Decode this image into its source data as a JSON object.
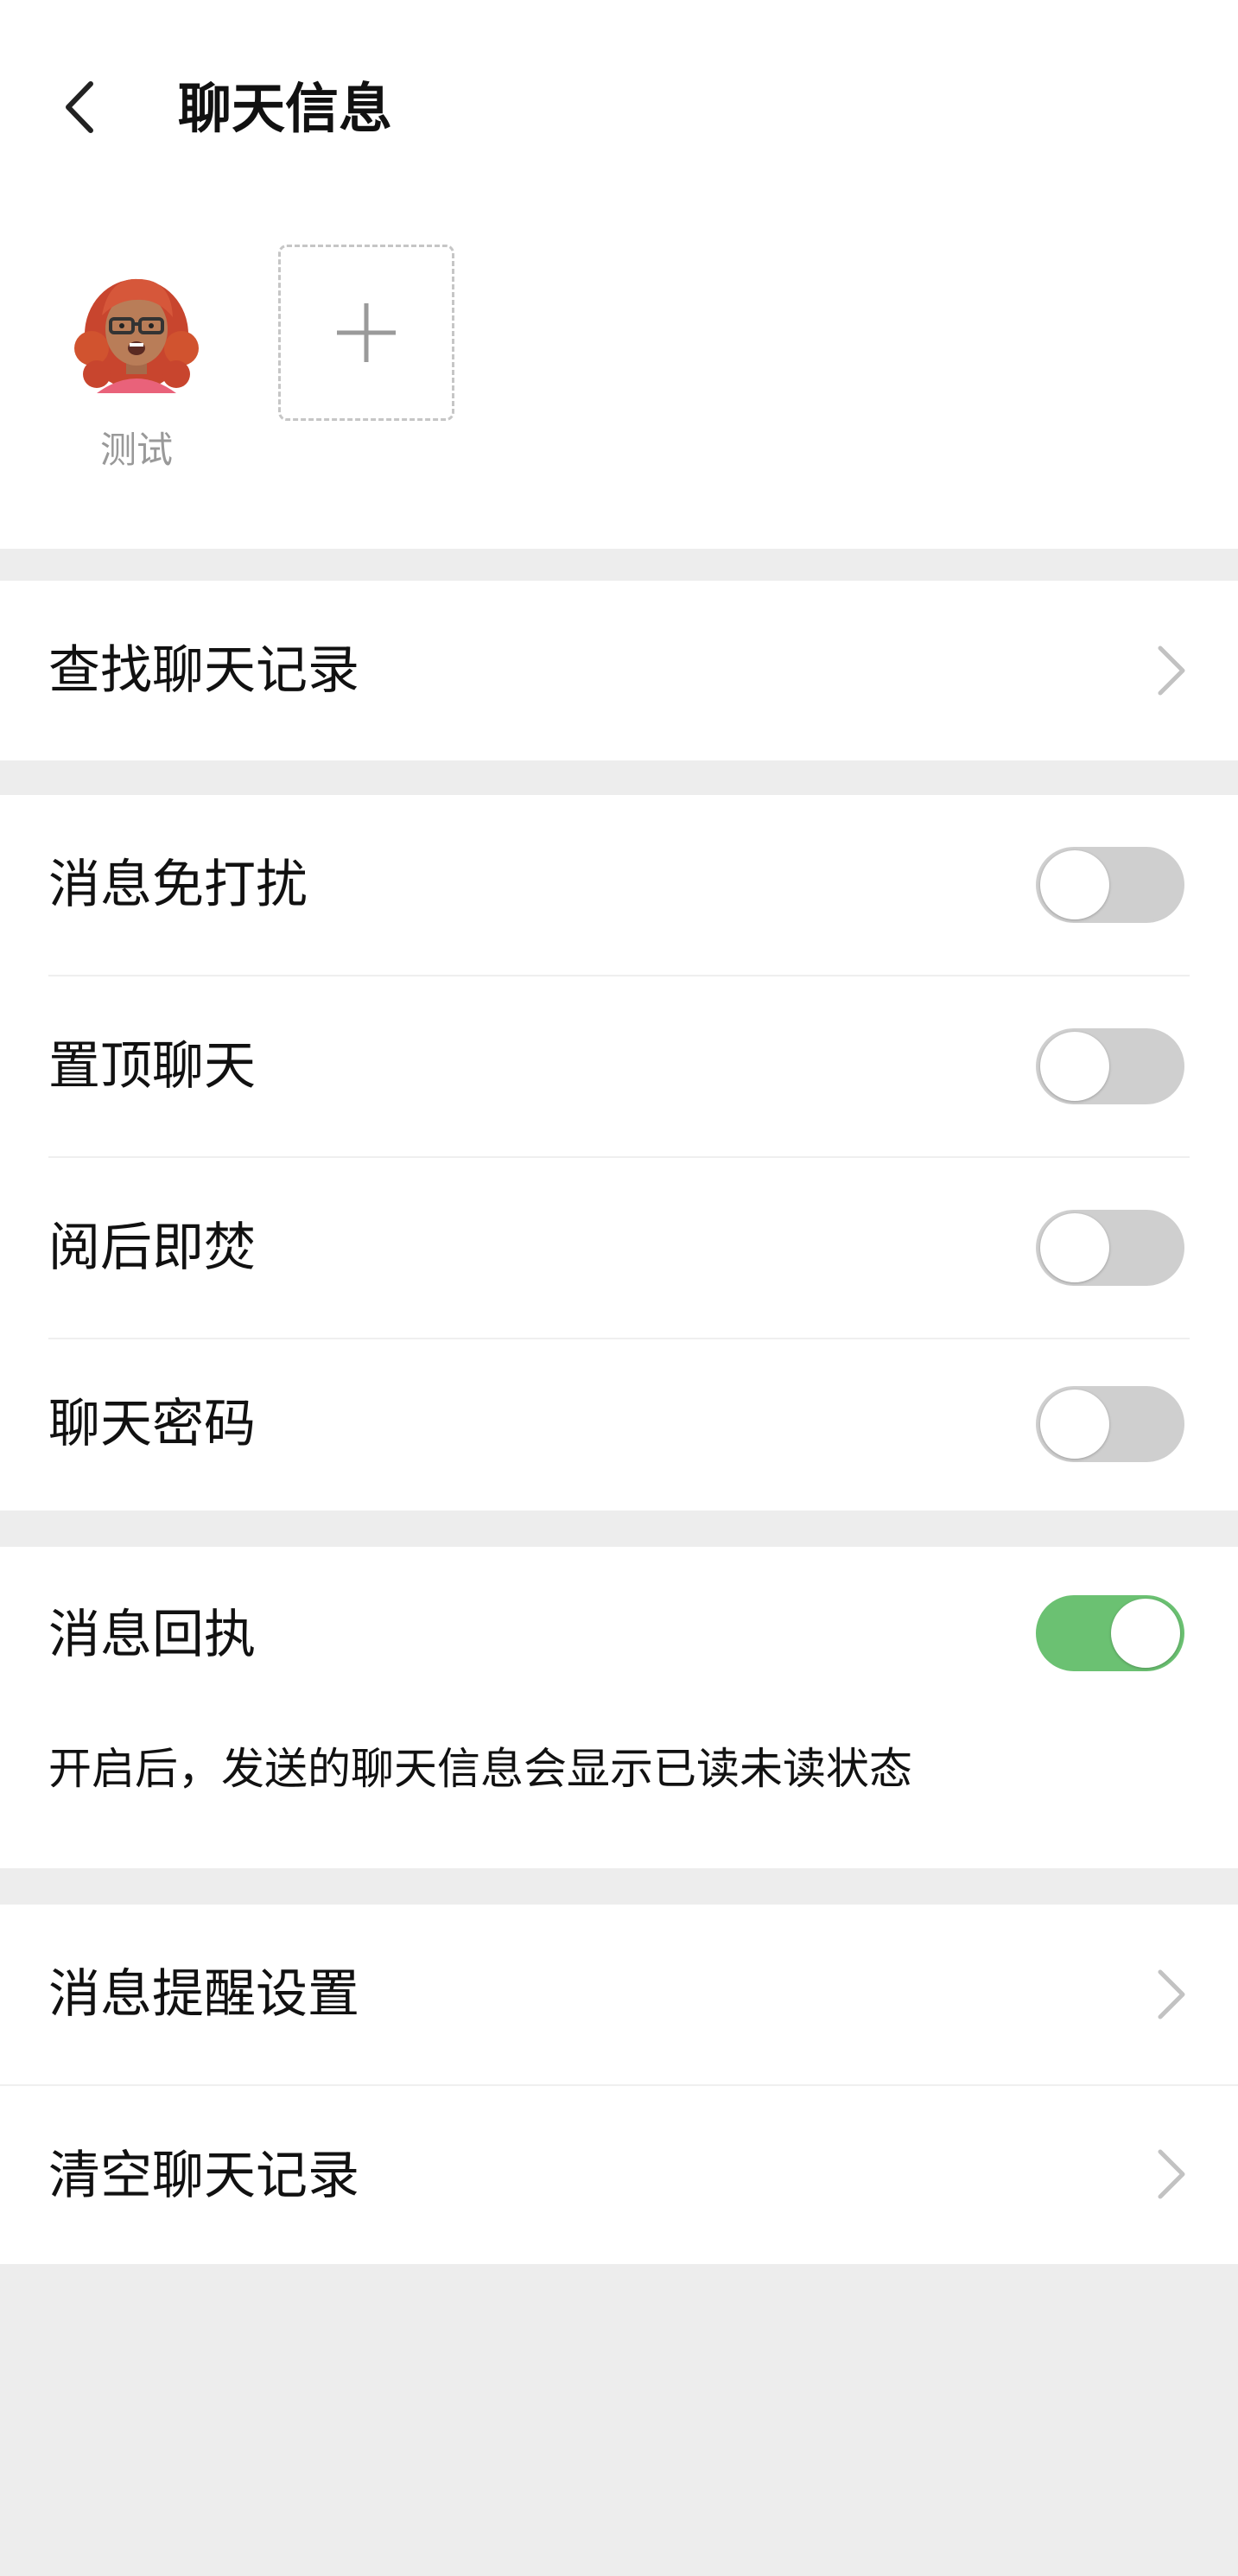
{
  "header": {
    "title": "聊天信息"
  },
  "members": [
    {
      "name": "测试"
    }
  ],
  "search_section": {
    "label": "查找聊天记录"
  },
  "toggles": [
    {
      "label": "消息免打扰",
      "on": false
    },
    {
      "label": "置顶聊天",
      "on": false
    },
    {
      "label": "阅后即焚",
      "on": false
    },
    {
      "label": "聊天密码",
      "on": false
    }
  ],
  "receipt": {
    "label": "消息回执",
    "on": true,
    "hint": "开启后，发送的聊天信息会显示已读未读状态"
  },
  "bottom_rows": [
    {
      "label": "消息提醒设置"
    },
    {
      "label": "清空聊天记录"
    }
  ],
  "colors": {
    "toggle_on": "#6bc172",
    "toggle_off": "#cfcfcf",
    "background": "#ededed"
  }
}
